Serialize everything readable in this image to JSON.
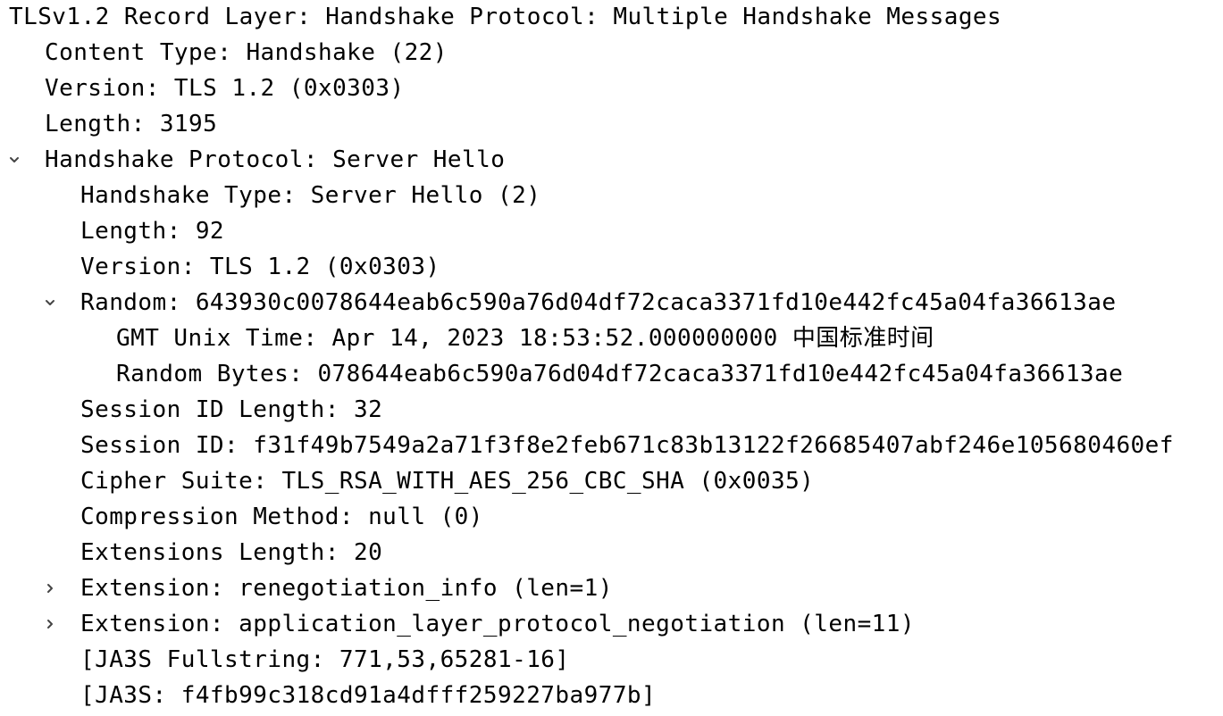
{
  "rows": [
    {
      "level": 0,
      "toggle": "none",
      "text": "TLSv1.2 Record Layer: Handshake Protocol: Multiple Handshake Messages"
    },
    {
      "level": 1,
      "toggle": "none",
      "text": "Content Type: Handshake (22)"
    },
    {
      "level": 1,
      "toggle": "none",
      "text": "Version: TLS 1.2 (0x0303)"
    },
    {
      "level": 1,
      "toggle": "none",
      "text": "Length: 3195"
    },
    {
      "level": 1,
      "toggle": "expanded",
      "text": "Handshake Protocol: Server Hello"
    },
    {
      "level": 2,
      "toggle": "none",
      "text": "Handshake Type: Server Hello (2)"
    },
    {
      "level": 2,
      "toggle": "none",
      "text": "Length: 92"
    },
    {
      "level": 2,
      "toggle": "none",
      "text": "Version: TLS 1.2 (0x0303)"
    },
    {
      "level": 2,
      "toggle": "expanded",
      "text": "Random: 643930c0078644eab6c590a76d04df72caca3371fd10e442fc45a04fa36613ae"
    },
    {
      "level": 3,
      "toggle": "none",
      "text": "GMT Unix Time: Apr 14, 2023 18:53:52.000000000 中国标准时间"
    },
    {
      "level": 3,
      "toggle": "none",
      "text": "Random Bytes: 078644eab6c590a76d04df72caca3371fd10e442fc45a04fa36613ae"
    },
    {
      "level": 2,
      "toggle": "none",
      "text": "Session ID Length: 32"
    },
    {
      "level": 2,
      "toggle": "none",
      "text": "Session ID: f31f49b7549a2a71f3f8e2feb671c83b13122f26685407abf246e105680460ef"
    },
    {
      "level": 2,
      "toggle": "none",
      "text": "Cipher Suite: TLS_RSA_WITH_AES_256_CBC_SHA (0x0035)"
    },
    {
      "level": 2,
      "toggle": "none",
      "text": "Compression Method: null (0)"
    },
    {
      "level": 2,
      "toggle": "none",
      "text": "Extensions Length: 20"
    },
    {
      "level": 2,
      "toggle": "collapsed",
      "text": "Extension: renegotiation_info (len=1)"
    },
    {
      "level": 2,
      "toggle": "collapsed",
      "text": "Extension: application_layer_protocol_negotiation (len=11)"
    },
    {
      "level": 2,
      "toggle": "none",
      "text": "[JA3S Fullstring: 771,53,65281-16]"
    },
    {
      "level": 2,
      "toggle": "none",
      "text": "[JA3S: f4fb99c318cd91a4dfff259227ba977b]"
    }
  ],
  "colors": {
    "text": "#000000",
    "toggle": "#444444",
    "background": "#ffffff"
  }
}
